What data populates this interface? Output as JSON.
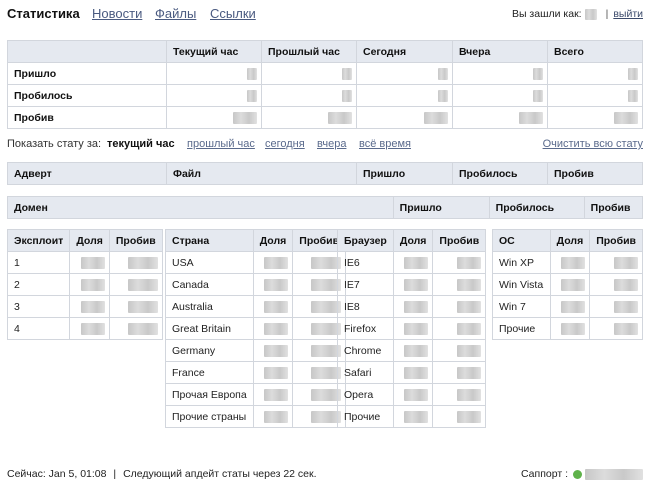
{
  "header": {
    "title": "Статистика",
    "nav": [
      "Новости",
      "Файлы",
      "Ссылки"
    ],
    "logged_in_label": "Вы зашли как:",
    "separator": "|",
    "logout": "выйти"
  },
  "summary": {
    "columns": [
      "",
      "Текущий час",
      "Прошлый час",
      "Сегодня",
      "Вчера",
      "Всего"
    ],
    "rows": [
      "Пришло",
      "Пробилось",
      "Пробив"
    ]
  },
  "filter": {
    "label": "Показать стату за:",
    "current": "текущий час",
    "options": [
      "прошлый час",
      "сегодня",
      "вчера",
      "всё время"
    ],
    "clear": "Очистить всю стату"
  },
  "advert_table": {
    "columns": [
      "Адверт",
      "Файл",
      "Пришло",
      "Пробилось",
      "Пробив"
    ]
  },
  "domain_table": {
    "columns": [
      "Домен",
      "",
      "Пришло",
      "Пробилось",
      "Пробив"
    ]
  },
  "exploit_table": {
    "columns": [
      "Эксплоит",
      "Доля",
      "Пробив"
    ],
    "rows": [
      "1",
      "2",
      "3",
      "4"
    ]
  },
  "country_table": {
    "columns": [
      "Страна",
      "Доля",
      "Пробив"
    ],
    "rows": [
      "USA",
      "Canada",
      "Australia",
      "Great Britain",
      "Germany",
      "France",
      "Прочая Европа",
      "Прочие страны"
    ]
  },
  "browser_table": {
    "columns": [
      "Браузер",
      "Доля",
      "Пробив"
    ],
    "rows": [
      "IE6",
      "IE7",
      "IE8",
      "Firefox",
      "Chrome",
      "Safari",
      "Opera",
      "Прочие"
    ]
  },
  "os_table": {
    "columns": [
      "ОС",
      "Доля",
      "Пробив"
    ],
    "rows": [
      "Win XP",
      "Win Vista",
      "Win 7",
      "Прочие"
    ]
  },
  "footer": {
    "now": "Сейчас: Jan 5, 01:08",
    "separator": "|",
    "next_update": "Следующий апдейт статы через 22 сек.",
    "support": "Саппорт :"
  },
  "colors": {
    "header_bg": "#e5e9f0",
    "border": "#d2d6dd",
    "link": "#4a5a80",
    "status_online": "#5fb24a"
  }
}
